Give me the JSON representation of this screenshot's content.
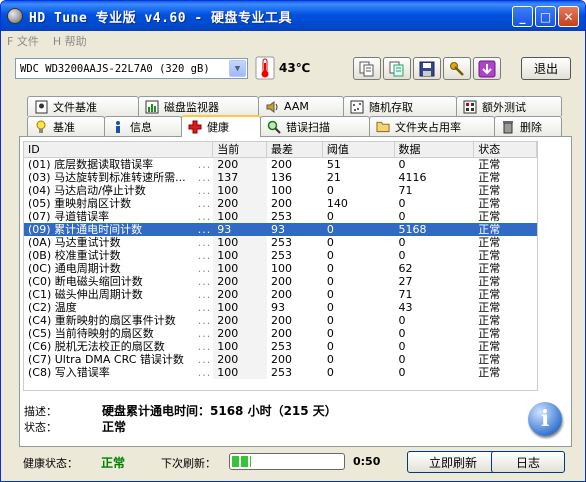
{
  "window": {
    "title": "HD Tune 专业版 v4.60 - 硬盘专业工具"
  },
  "menu": {
    "file": "F 文件",
    "help": "H 帮助"
  },
  "toolbar": {
    "drive": "WDC WD3200AAJS-22L7A0 (320 gB)",
    "temperature": "43℃",
    "exit_label": "退出"
  },
  "tabs_top": [
    {
      "label": "文件基准",
      "icon": "file-benchmark-icon"
    },
    {
      "label": "磁盘监视器",
      "icon": "disk-monitor-icon"
    },
    {
      "label": "AAM",
      "icon": "speaker-icon"
    },
    {
      "label": "随机存取",
      "icon": "random-access-icon"
    },
    {
      "label": "额外测试",
      "icon": "extra-tests-icon"
    }
  ],
  "tabs_bottom": [
    {
      "label": "基准",
      "icon": "lightbulb-icon"
    },
    {
      "label": "信息",
      "icon": "info-icon"
    },
    {
      "label": "健康",
      "icon": "health-cross-icon"
    },
    {
      "label": "错误扫描",
      "icon": "magnifier-icon"
    },
    {
      "label": "文件夹占用率",
      "icon": "folder-icon"
    },
    {
      "label": "删除",
      "icon": "trash-icon"
    }
  ],
  "smart_table": {
    "columns": [
      "ID",
      "当前",
      "最差",
      "阈值",
      "数据",
      "状态"
    ],
    "selected_index": 5,
    "rows": [
      [
        "(01) 底层数据读取错误率",
        "200",
        "200",
        "51",
        "0",
        "正常"
      ],
      [
        "(03) 马达旋转到标准转速所需...",
        "137",
        "136",
        "21",
        "4116",
        "正常"
      ],
      [
        "(04) 马达启动/停止计数",
        "100",
        "100",
        "0",
        "71",
        "正常"
      ],
      [
        "(05) 重映射扇区计数",
        "200",
        "200",
        "140",
        "0",
        "正常"
      ],
      [
        "(07) 寻道错误率",
        "100",
        "253",
        "0",
        "0",
        "正常"
      ],
      [
        "(09) 累计通电时间计数",
        "93",
        "93",
        "0",
        "5168",
        "正常"
      ],
      [
        "(0A) 马达重试计数",
        "100",
        "253",
        "0",
        "0",
        "正常"
      ],
      [
        "(0B) 校准重试计数",
        "100",
        "253",
        "0",
        "0",
        "正常"
      ],
      [
        "(0C) 通电周期计数",
        "100",
        "100",
        "0",
        "62",
        "正常"
      ],
      [
        "(C0) 断电磁头缩回计数",
        "200",
        "200",
        "0",
        "27",
        "正常"
      ],
      [
        "(C1) 磁头伸出周期计数",
        "200",
        "200",
        "0",
        "71",
        "正常"
      ],
      [
        "(C2) 温度",
        "100",
        "93",
        "0",
        "43",
        "正常"
      ],
      [
        "(C4) 重新映射的扇区事件计数",
        "200",
        "200",
        "0",
        "0",
        "正常"
      ],
      [
        "(C5) 当前待映射的扇区数",
        "200",
        "200",
        "0",
        "0",
        "正常"
      ],
      [
        "(C6) 脱机无法校正的扇区数",
        "100",
        "253",
        "0",
        "0",
        "正常"
      ],
      [
        "(C7) Ultra DMA CRC 错误计数",
        "200",
        "200",
        "0",
        "0",
        "正常"
      ],
      [
        "(C8) 写入错误率",
        "100",
        "253",
        "0",
        "0",
        "正常"
      ]
    ]
  },
  "details": {
    "desc_label": "描述：",
    "desc_value": "硬盘累计通电时间：5168 小时（215 天）",
    "state_label": "状态：",
    "state_value": "正常"
  },
  "status": {
    "health_label": "健康状态：",
    "health_value": "正常",
    "refresh_label": "下次刷新：",
    "refresh_progress": 0.17,
    "countdown": "0:50",
    "refresh_now_label": "立即刷新",
    "log_label": "日志"
  }
}
